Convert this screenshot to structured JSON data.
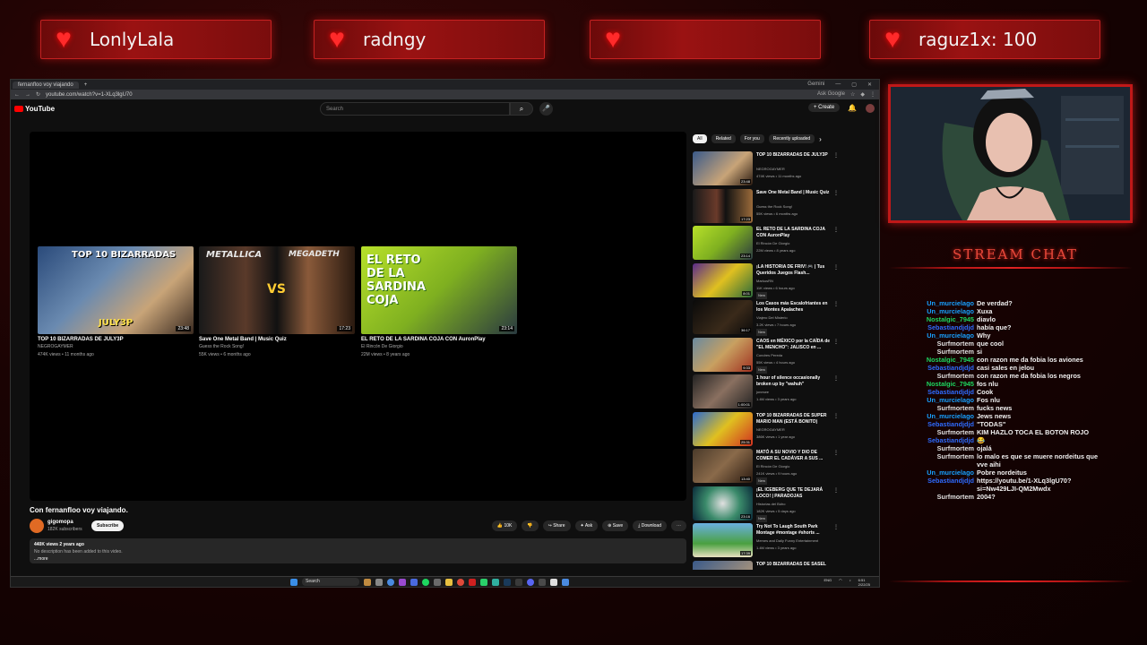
{
  "banners": [
    "LonlyLala",
    "radngy",
    "",
    "raguz1x: 100"
  ],
  "browser": {
    "tab_label": "fernanfloo voy viajando",
    "window_controls": [
      "Gemini",
      "—",
      "▢",
      "✕"
    ],
    "url": "youtube.com/watch?v=1-XLq3lgU70",
    "ask_google": "Ask Google",
    "logo": "YouTube",
    "search_placeholder": "Search",
    "create_label": "+ Create",
    "endcards": [
      {
        "title": "TOP 10 BIZARRADAS DE JULY3P",
        "channel": "NEGROGAYMER",
        "meta": "474K views • 11 months ago",
        "duration": "23:48",
        "thumb_text": "TOP 10 BIZARRADAS",
        "thumb_sub": "JULY3P"
      },
      {
        "title": "Save One Metal Band | Music Quiz",
        "channel": "Guess the Rock Song!",
        "meta": "55K views • 6 months ago",
        "duration": "17:23",
        "thumb_text": "METALLICA",
        "thumb_sub": "MEGADETH"
      },
      {
        "title": "EL RETO DE LA SARDINA COJA CON AuronPlay",
        "channel": "El Rincón De Giorgio",
        "meta": "22M views • 8 years ago",
        "duration": "23:14",
        "thumb_text": "EL RETO DE LA SARDINA COJA",
        "thumb_sub": ""
      }
    ],
    "video_title": "Con fernanfloo voy viajando.",
    "channel_name": "gigomopa",
    "channel_subs": "182K subscribers",
    "subscribe_label": "Subscribe",
    "actions": [
      "👍 10K",
      "👎",
      "↪ Share",
      "✦ Ask",
      "⊕ Save",
      "⤓ Download",
      "⋯"
    ],
    "desc_stats": "440K views  2 years ago",
    "desc_text": "No description has been added to this video.",
    "desc_more": "...more",
    "chips": [
      "All",
      "Related",
      "For you",
      "Recently uploaded"
    ],
    "recs": [
      {
        "title": "TOP 10 BIZARRADAS DE JULY3P",
        "channel": "NEGROGAYMER",
        "meta": "474K views • 11 months ago",
        "duration": "23:48",
        "badge": ""
      },
      {
        "title": "Save One Metal Band | Music Quiz",
        "channel": "Guess the Rock Song!",
        "meta": "55K views • 6 months ago",
        "duration": "17:23",
        "badge": ""
      },
      {
        "title": "EL RETO DE LA SARDINA COJA CON AuronPlay",
        "channel": "El Rincón De Giorgio",
        "meta": "22M views • 8 years ago",
        "duration": "23:14",
        "badge": ""
      },
      {
        "title": "¡LA HISTORIA DE FRIV! 🎮 | Tus Queridos Juegos Flash...",
        "channel": "MarkusRN",
        "meta": "11K views • 6 hours ago",
        "duration": "8:01",
        "badge": "New"
      },
      {
        "title": "Los Casos más Escalofriantes en los Montes Apalaches",
        "channel": "Viajero Del Misterio",
        "meta": "3.2K views • 7 hours ago",
        "duration": "36:17",
        "badge": "New"
      },
      {
        "title": "CAOS en MÉXICO por la CAÍDA de \"EL MENCHO\": JALISCO en ...",
        "channel": "Condres Pereda",
        "meta": "55K views • 4 hours ago",
        "duration": "9:33",
        "badge": "New"
      },
      {
        "title": "1 hour of silence occasionally broken up by \"wahuh\"",
        "channel": "jonesee",
        "meta": "1.4M views • 3 years ago",
        "duration": "1:00:01",
        "badge": ""
      },
      {
        "title": "TOP 10 BIZARRADAS DE SUPER MARIO MAN (ESTÁ BONITO)",
        "channel": "NEGROGAYMER",
        "meta": "386K views • 1 year ago",
        "duration": "25:31",
        "badge": ""
      },
      {
        "title": "MATÓ A SU NOVIO Y DIO DE COMER EL CADÁVER A SUS ...",
        "channel": "El Rincón De Giorgio",
        "meta": "241K views • 9 hours ago",
        "duration": "13:40",
        "badge": "New"
      },
      {
        "title": "¡EL ICEBERG QUE TE DEJARÁ LOCO! | PARADOJAS",
        "channel": "Historias del Búho",
        "meta": "182K views • 5 days ago",
        "duration": "23:16",
        "badge": "New"
      },
      {
        "title": "Try Not To Laugh South Park Montage #montage #shorts ...",
        "channel": "Memes and Daily Funny Entertainment",
        "meta": "1.4M views • 3 years ago",
        "duration": "17:39",
        "badge": ""
      },
      {
        "title": "TOP 10 BIZARRADAS DE SASEL",
        "channel": "",
        "meta": "",
        "duration": "",
        "badge": ""
      }
    ],
    "taskbar_search": "Search",
    "tray": [
      "ENG",
      "6:51",
      "2/22/25"
    ]
  },
  "chat": {
    "title": "STREAM CHAT",
    "messages": [
      {
        "user": "Un_murcielago",
        "text": "De verdad?",
        "color": "#18a0ff"
      },
      {
        "user": "Un_murcielago",
        "text": "Xuxa",
        "color": "#18a0ff"
      },
      {
        "user": "Nostalgic_7945",
        "text": "diavlo",
        "color": "#1ed760"
      },
      {
        "user": "Sebastiandjdjd",
        "text": "había que?",
        "color": "#2f6bff"
      },
      {
        "user": "Un_murcielago",
        "text": "Why",
        "color": "#18a0ff"
      },
      {
        "user": "Surfmortem",
        "text": "que cool",
        "color": "#e0e0e0"
      },
      {
        "user": "Surfmortem",
        "text": "si",
        "color": "#e0e0e0"
      },
      {
        "user": "Nostalgic_7945",
        "text": "con razon me da fobia los aviones",
        "color": "#1ed760"
      },
      {
        "user": "Sebastiandjdjd",
        "text": "casi sales en jelou",
        "color": "#2f6bff"
      },
      {
        "user": "Surfmortem",
        "text": "con razon me da fobia los negros",
        "color": "#e0e0e0"
      },
      {
        "user": "Nostalgic_7945",
        "text": "fos nlu",
        "color": "#1ed760"
      },
      {
        "user": "Sebastiandjdjd",
        "text": "Cook",
        "color": "#2f6bff"
      },
      {
        "user": "Un_murcielago",
        "text": "Fos nlu",
        "color": "#18a0ff"
      },
      {
        "user": "Surfmortem",
        "text": "fucks news",
        "color": "#e0e0e0"
      },
      {
        "user": "Un_murcielago",
        "text": "Jews news",
        "color": "#18a0ff"
      },
      {
        "user": "Sebastiandjdjd",
        "text": "\"TODAS\"",
        "color": "#2f6bff"
      },
      {
        "user": "Surfmortem",
        "text": "KIM HAZLO TOCA EL BOTON ROJO",
        "color": "#e0e0e0"
      },
      {
        "user": "Sebastiandjdjd",
        "text": "😂",
        "color": "#2f6bff"
      },
      {
        "user": "Surfmortem",
        "text": "ojalá",
        "color": "#e0e0e0"
      },
      {
        "user": "Surfmortem",
        "text": "lo malo es que se muere nordeitus que vve aihi",
        "color": "#e0e0e0"
      },
      {
        "user": "Un_murcielago",
        "text": "Pobre nordeitus",
        "color": "#18a0ff"
      },
      {
        "user": "Sebastiandjdjd",
        "text": "https://youtu.be/1-XLq3lgU70?si=Nw429LJI-QM2Mwdx",
        "color": "#2f6bff"
      },
      {
        "user": "Surfmortem",
        "text": "2004?",
        "color": "#e0e0e0"
      }
    ]
  }
}
